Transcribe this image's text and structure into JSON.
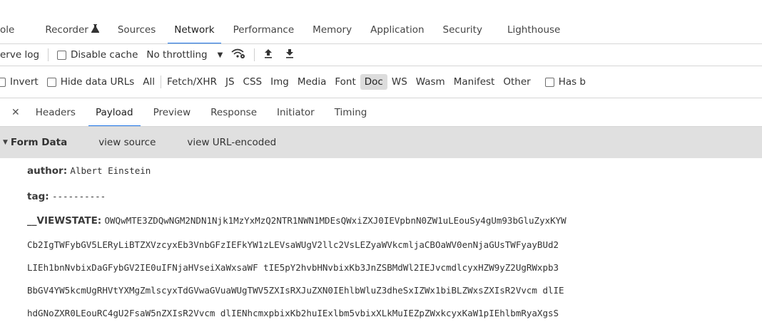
{
  "main_tabs": [
    "ole",
    "Recorder",
    "Sources",
    "Network",
    "Performance",
    "Memory",
    "Application",
    "Security",
    "Lighthouse"
  ],
  "main_tabs_active": "Network",
  "toolbar": {
    "preserve_log": "erve log",
    "disable_cache": "Disable cache",
    "throttling": "No throttling"
  },
  "filters": {
    "invert": "Invert",
    "hide_data_urls": "Hide data URLs",
    "types": [
      "All",
      "Fetch/XHR",
      "JS",
      "CSS",
      "Img",
      "Media",
      "Font",
      "Doc",
      "WS",
      "Wasm",
      "Manifest",
      "Other"
    ],
    "active_type": "Doc",
    "has_blocked": "Has b"
  },
  "sub_tabs": [
    "Headers",
    "Payload",
    "Preview",
    "Response",
    "Initiator",
    "Timing"
  ],
  "sub_tabs_active": "Payload",
  "form_data": {
    "title": "Form Data",
    "view_source": "view source",
    "view_url_encoded": "view URL-encoded",
    "author_key": "author:",
    "author_value": "Albert Einstein",
    "tag_key": "tag:",
    "tag_value": "----------",
    "viewstate_key": "__VIEWSTATE:",
    "viewstate_lines": [
      "OWQwMTE3ZDQwNGM2NDN1Njk1MzYxMzQ2NTR1NWN1MDEsQWxiZXJ0IEVpbnN0ZW1uLEouSy4gUm93bGluZyxKYW",
      "Cb2IgTWFybGV5LERyLiBTZXVzcyxEb3VnbGFzIEFkYW1zLEVsaWUgV2llc2VsLEZyaWVkcmljaCBOaWV0enNjaGUsTWFyayBUd2",
      "LIEh1bnNvbixDaGFybGV2IE0uIFNjaHVseiXaWxsaWF tIE5pY2hvbHNvbixKb3JnZSBMdWl2IEJvcmdlcyxHZW9yZ2UgRWxpb3",
      "BbGV4YW5kcmUgRHVtYXMgZmlscyxTdGVwaGVuaWUgTWV5ZXIsRXJuZXN0IEhlbWluZ3dheSxIZWx1biBLZWxsZXIsR2Vvcm dlIE",
      "hdGNoZXR0LEouRC4gU2FsaW5nZXIsR2Vvcm dlIENhcmxpbixKb2huIExlbm5vbixXLkMuIEZpZWxkcyxKaW1pIEhlbmRyaXgsS"
    ]
  }
}
